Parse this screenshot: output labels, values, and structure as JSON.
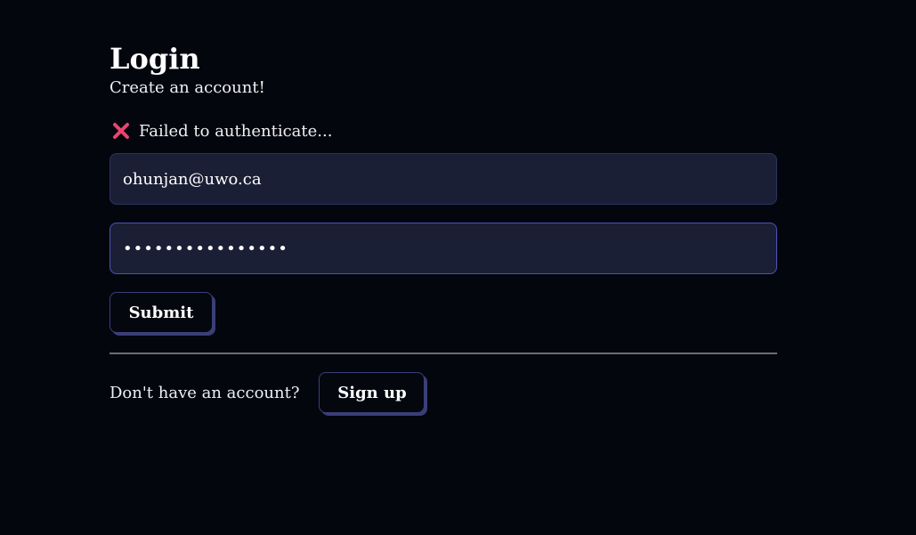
{
  "login": {
    "title": "Login",
    "subtitle": "Create an account!",
    "error_message": "Failed to authenticate...",
    "error_icon": "cross-mark-icon",
    "error_color": "#e8456e",
    "email_value": "ohunjan@uwo.ca",
    "password_mask": "••••••••••••••••",
    "submit_label": "Submit",
    "signup_prompt": "Don't have an account?",
    "signup_label": "Sign up"
  }
}
